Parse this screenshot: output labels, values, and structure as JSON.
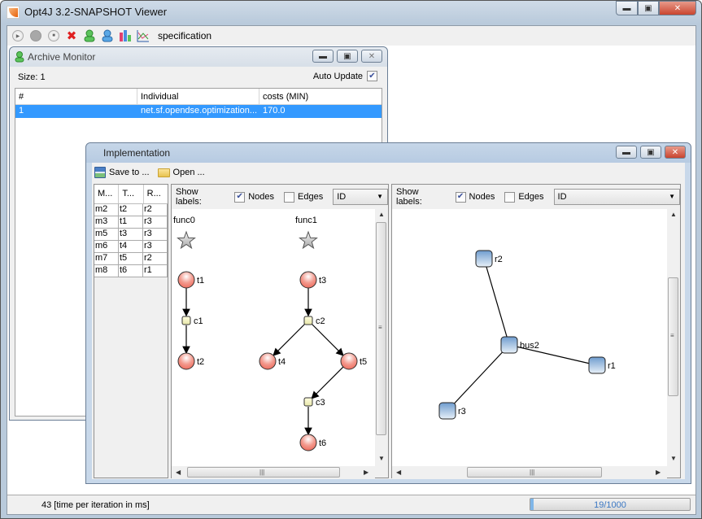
{
  "app": {
    "title": "Opt4J 3.2-SNAPSHOT Viewer"
  },
  "toolbar": {
    "items": [
      {
        "icon": "play-icon"
      },
      {
        "icon": "stop-icon"
      },
      {
        "icon": "pause-icon"
      },
      {
        "icon": "close-red-x-icon"
      },
      {
        "icon": "green-user-icon"
      },
      {
        "icon": "blue-user-icon"
      },
      {
        "icon": "bar-chart-icon"
      },
      {
        "icon": "line-chart-icon"
      }
    ],
    "spec_label": "specification"
  },
  "archive_monitor": {
    "title": "Archive Monitor",
    "size_label": "Size: 1",
    "auto_update_label": "Auto Update",
    "auto_update_checked": true,
    "columns": [
      "#",
      "Individual",
      "costs (MIN)"
    ],
    "rows": [
      {
        "index": "1",
        "individual": "net.sf.opendse.optimization...",
        "costs": "170.0",
        "selected": true
      }
    ]
  },
  "implementation": {
    "title": "Implementation",
    "save_label": "Save to ...",
    "open_label": "Open ...",
    "mapping_table": {
      "columns": [
        "M...",
        "T...",
        "R..."
      ],
      "rows": [
        [
          "m2",
          "t2",
          "r2"
        ],
        [
          "m3",
          "t1",
          "r3"
        ],
        [
          "m5",
          "t3",
          "r3"
        ],
        [
          "m6",
          "t4",
          "r3"
        ],
        [
          "m7",
          "t5",
          "r2"
        ],
        [
          "m8",
          "t6",
          "r1"
        ]
      ]
    },
    "app_panel": {
      "show_labels": "Show labels:",
      "nodes_label": "Nodes",
      "nodes_checked": true,
      "edges_label": "Edges",
      "edges_checked": false,
      "select_value": "ID",
      "graph": {
        "functions": [
          "func0",
          "func1"
        ],
        "tasks": [
          "t1",
          "t2",
          "t3",
          "t4",
          "t5",
          "t6"
        ],
        "communications": [
          "c1",
          "c2",
          "c3"
        ],
        "edges": [
          [
            "t1",
            "c1"
          ],
          [
            "c1",
            "t2"
          ],
          [
            "t3",
            "c2"
          ],
          [
            "c2",
            "t4"
          ],
          [
            "c2",
            "t5"
          ],
          [
            "t5",
            "c3"
          ],
          [
            "c3",
            "t6"
          ]
        ]
      }
    },
    "arch_panel": {
      "show_labels": "Show labels:",
      "nodes_label": "Nodes",
      "nodes_checked": true,
      "edges_label": "Edges",
      "edges_checked": false,
      "select_value": "ID",
      "graph": {
        "resources": [
          "r1",
          "r2",
          "r3",
          "bus2"
        ],
        "edges": [
          [
            "bus2",
            "r1"
          ],
          [
            "bus2",
            "r2"
          ],
          [
            "bus2",
            "r3"
          ]
        ]
      }
    }
  },
  "status": {
    "text": "43  [time per iteration in ms]",
    "progress_text": "19/1000",
    "progress_fraction": 0.019
  }
}
